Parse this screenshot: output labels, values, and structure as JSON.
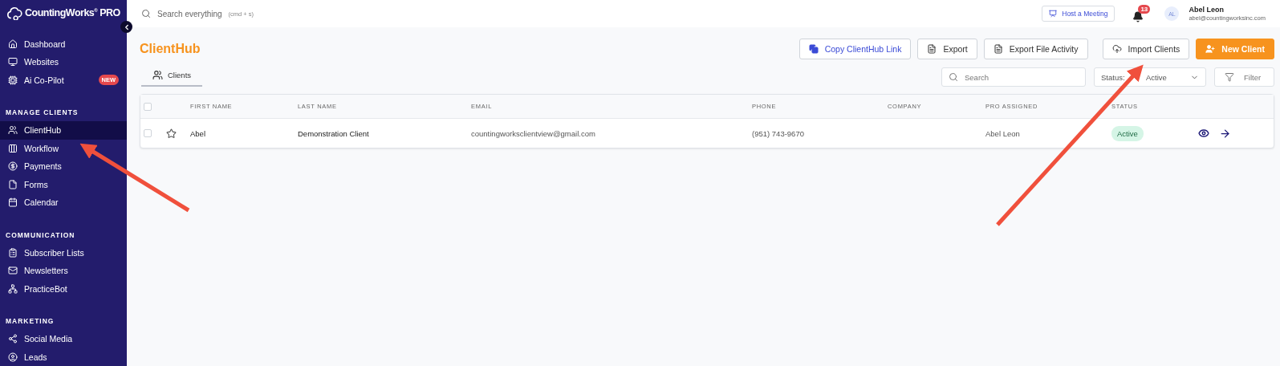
{
  "sidebar": {
    "logo": "CountingWorks$^{®}$ PRO",
    "sections": [
      {
        "items": [
          {
            "label": "Dashboard",
            "selected": false
          },
          {
            "label": "Websites",
            "selected": false
          },
          {
            "label": "Ai Co-Pilot",
            "selected": false,
            "badge": "NEW"
          }
        ]
      },
      {
        "heading": "MANAGE CLIENTS",
        "items": [
          {
            "label": "ClientHub",
            "selected": true
          },
          {
            "label": "Workflow",
            "selected": false
          },
          {
            "label": "Payments",
            "selected": false
          },
          {
            "label": "Forms",
            "selected": false
          },
          {
            "label": "Calendar",
            "selected": false
          }
        ]
      },
      {
        "heading": "COMMUNICATION",
        "items": [
          {
            "label": "Subscriber Lists",
            "selected": false
          },
          {
            "label": "Newsletters",
            "selected": false
          },
          {
            "label": "PracticeBot",
            "selected": false
          }
        ]
      },
      {
        "heading": "MARKETING",
        "items": [
          {
            "label": "Social Media",
            "selected": false
          },
          {
            "label": "Leads",
            "selected": false
          }
        ]
      }
    ]
  },
  "topbar": {
    "search": {
      "placeholder": "Search everything",
      "shortcut": "(cmd + s)"
    },
    "meeting_button": "Host a Meeting",
    "notifications": "13",
    "user": {
      "initials": "AL",
      "name": "Abel Leon",
      "email": "abel@countingworksinc.com"
    }
  },
  "page": {
    "title": "ClientHub",
    "actions": [
      {
        "label": "Copy ClientHub Link",
        "kind": "link"
      },
      {
        "label": "Export",
        "kind": "doc"
      },
      {
        "label": "Export File Activity",
        "kind": "doc"
      },
      {
        "label": "Import Clients",
        "kind": "upload"
      },
      {
        "label": "New Client",
        "kind": "primary"
      }
    ],
    "tabs": [
      {
        "label": "Clients",
        "selected": true
      }
    ],
    "search": {
      "placeholder": "Search"
    },
    "status_filter": {
      "label": "Status:",
      "value": "Active"
    },
    "filter_button": "Filter"
  },
  "table": {
    "header_checked": false,
    "columns": [
      "FIRST NAME",
      "LAST NAME",
      "EMAIL",
      "PHONE",
      "COMPANY",
      "PRO ASSIGNED",
      "STATUS"
    ],
    "rows": [
      {
        "checked": false,
        "starred": false,
        "first_name": "Abel",
        "last_name": "Demonstration Client",
        "email": "countingworksclientview@gmail.com",
        "phone": "(951) 743-9670",
        "pro_assigned": "Abel Leon",
        "status": "Active"
      }
    ]
  }
}
